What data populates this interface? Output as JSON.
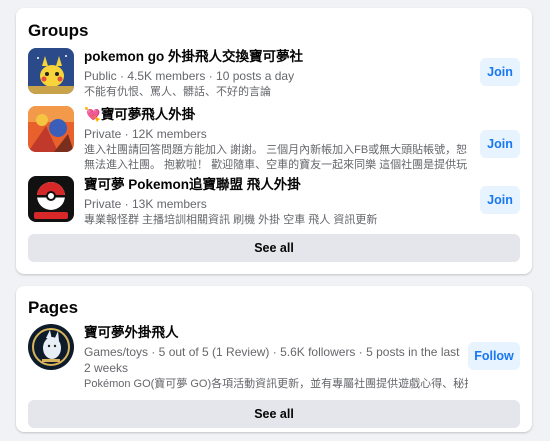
{
  "groups": {
    "title": "Groups",
    "items": [
      {
        "name": "pokemon go 外掛飛人交換寶可夢社",
        "meta": "Public · 4.5K members · 10 posts a day",
        "description": "不能有仇恨、罵人、髒話、不好的言論",
        "action": "Join"
      },
      {
        "name_prefix": "💘",
        "name": "寶可夢飛人外掛",
        "meta": "Private · 12K members",
        "description": "進入社團請回答問題方能加入 謝謝。 三個月內新帳加入FB或無大頭貼帳號，恕無法進入社團。 抱歉啦！ 歡迎隨車、空車的寶友一起來同樂 這個社團是提供玩家各項資訊與交...",
        "action": "Join"
      },
      {
        "name": "寶可夢 Pokemon追寶聯盟 飛人外掛",
        "meta": "Private · 13K members",
        "description": "專業報怪群 主播培訓相關資訊 刷機 外掛 空車 飛人 資訊更新",
        "action": "Join"
      }
    ],
    "see_all": "See all"
  },
  "pages": {
    "title": "Pages",
    "items": [
      {
        "name": "寶可夢外掛飛人",
        "meta": "Games/toys · 5 out of 5 (1 Review) · 5.6K followers · 5 posts in the last 2 weeks",
        "description": "Pokémon GO(寶可夢 GO)各項活動資訊更新，並有專屬社團提供遊戲心得、秘技。",
        "action": "Follow"
      }
    ],
    "see_all": "See all"
  },
  "colors": {
    "accent": "#1877f2",
    "accent_bg": "#e7f3ff",
    "secondary_text": "#65676b",
    "button_bg": "#e4e6eb"
  },
  "icons": [
    "group-1-thumbnail",
    "group-2-thumbnail",
    "group-3-thumbnail",
    "page-avatar"
  ]
}
